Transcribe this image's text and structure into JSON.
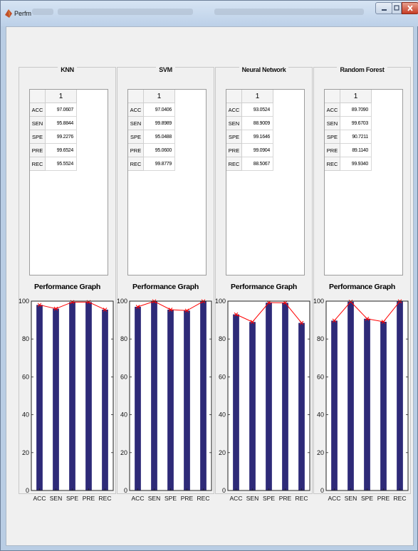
{
  "window": {
    "title": "Perfm"
  },
  "colors": {
    "bar": "#2e2a78",
    "line": "#ff0000",
    "marker": "#ff0000"
  },
  "panels": [
    {
      "title": "KNN",
      "table": {
        "column_header": "1",
        "rows": [
          {
            "label": "ACC",
            "value": "97.0607"
          },
          {
            "label": "SEN",
            "value": "95.8844"
          },
          {
            "label": "SPE",
            "value": "99.2276"
          },
          {
            "label": "PRE",
            "value": "99.6524"
          },
          {
            "label": "REC",
            "value": "95.5524"
          }
        ]
      },
      "chart_title": "Performance Graph"
    },
    {
      "title": "SVM",
      "table": {
        "column_header": "1",
        "rows": [
          {
            "label": "ACC",
            "value": "97.0406"
          },
          {
            "label": "SEN",
            "value": "99.8989"
          },
          {
            "label": "SPE",
            "value": "95.0488"
          },
          {
            "label": "PRE",
            "value": "95.0600"
          },
          {
            "label": "REC",
            "value": "99.8779"
          }
        ]
      },
      "chart_title": "Performance Graph"
    },
    {
      "title": "Neural Network",
      "table": {
        "column_header": "1",
        "rows": [
          {
            "label": "ACC",
            "value": "93.0524"
          },
          {
            "label": "SEN",
            "value": "88.9009"
          },
          {
            "label": "SPE",
            "value": "99.1646"
          },
          {
            "label": "PRE",
            "value": "99.0904"
          },
          {
            "label": "REC",
            "value": "88.5067"
          }
        ]
      },
      "chart_title": "Performance Graph"
    },
    {
      "title": "Random Forest",
      "table": {
        "column_header": "1",
        "rows": [
          {
            "label": "ACC",
            "value": "89.7090"
          },
          {
            "label": "SEN",
            "value": "99.6703"
          },
          {
            "label": "SPE",
            "value": "90.7211"
          },
          {
            "label": "PRE",
            "value": "89.1140"
          },
          {
            "label": "REC",
            "value": "99.9340"
          }
        ]
      },
      "chart_title": "Performance Graph"
    }
  ],
  "chart_data": [
    {
      "type": "bar",
      "title": "Performance Graph",
      "categories": [
        "ACC",
        "SEN",
        "SPE",
        "PRE",
        "REC"
      ],
      "values": [
        98,
        96,
        99.5,
        99.5,
        95.5
      ],
      "line_overlay": true,
      "ylim": [
        0,
        100
      ],
      "yticks": [
        "0",
        "20",
        "40",
        "60",
        "80",
        "100"
      ]
    },
    {
      "type": "bar",
      "title": "Performance Graph",
      "categories": [
        "ACC",
        "SEN",
        "SPE",
        "PRE",
        "REC"
      ],
      "values": [
        97,
        99.9,
        95.5,
        95,
        99.9
      ],
      "line_overlay": true,
      "ylim": [
        0,
        100
      ],
      "yticks": [
        "0",
        "20",
        "40",
        "60",
        "80",
        "100"
      ]
    },
    {
      "type": "bar",
      "title": "Performance Graph",
      "categories": [
        "ACC",
        "SEN",
        "SPE",
        "PRE",
        "REC"
      ],
      "values": [
        93,
        89,
        99.2,
        99.1,
        88.5
      ],
      "line_overlay": true,
      "ylim": [
        0,
        100
      ],
      "yticks": [
        "0",
        "20",
        "40",
        "60",
        "80",
        "100"
      ]
    },
    {
      "type": "bar",
      "title": "Performance Graph",
      "categories": [
        "ACC",
        "SEN",
        "SPE",
        "PRE",
        "REC"
      ],
      "values": [
        89.7,
        99.7,
        90.7,
        89.1,
        99.9
      ],
      "line_overlay": true,
      "ylim": [
        0,
        100
      ],
      "yticks": [
        "0",
        "20",
        "40",
        "60",
        "80",
        "100"
      ]
    }
  ]
}
